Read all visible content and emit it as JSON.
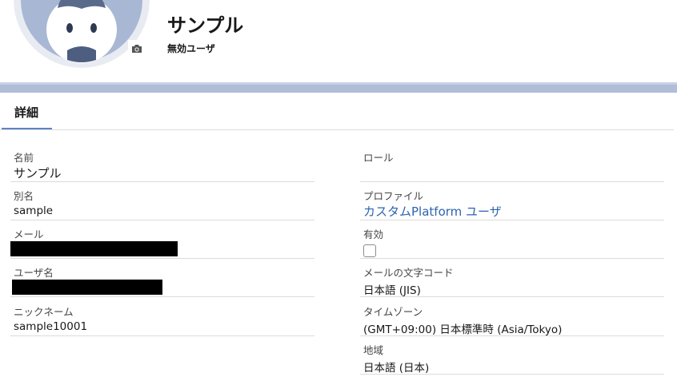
{
  "header": {
    "title": "サンプル",
    "subtitle": "無効ユーザ",
    "avatar_icon": "user-avatar-icon",
    "camera_icon": "camera-icon"
  },
  "tabs": [
    {
      "label": "詳細",
      "active": true
    }
  ],
  "details": {
    "left": {
      "name": {
        "label": "名前",
        "value": "サンプル"
      },
      "alias": {
        "label": "別名",
        "value": "sample"
      },
      "email": {
        "label": "メール",
        "value": ""
      },
      "username": {
        "label": "ユーザ名",
        "value": ""
      },
      "nickname": {
        "label": "ニックネーム",
        "value": "sample10001"
      }
    },
    "right": {
      "role": {
        "label": "ロール",
        "value": ""
      },
      "profile": {
        "label": "プロファイル",
        "value": "カスタムPlatform ユーザ"
      },
      "active": {
        "label": "有効",
        "checked": false
      },
      "email_encoding": {
        "label": "メールの文字コード",
        "value": "日本語 (JIS)"
      },
      "timezone": {
        "label": "タイムゾーン",
        "value": "(GMT+09:00) 日本標準時 (Asia/Tokyo)"
      },
      "locale": {
        "label": "地域",
        "value": "日本語 (日本)"
      }
    }
  },
  "colors": {
    "band": "#b0bdd7",
    "tab_accent": "#5d83c7",
    "link": "#2c64b0",
    "avatar_bg": "#a8b7d3",
    "avatar_face": "#ffffff",
    "avatar_ring": "#e8ebf2"
  }
}
